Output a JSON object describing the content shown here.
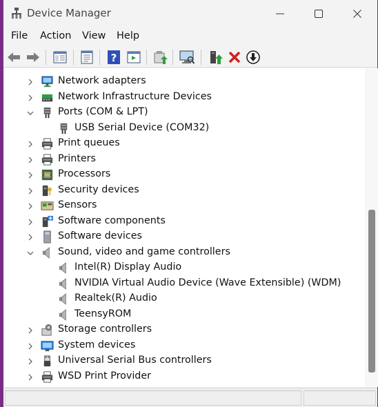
{
  "window": {
    "title": "Device Manager"
  },
  "menu": {
    "items": [
      "File",
      "Action",
      "View",
      "Help"
    ]
  },
  "toolbar": {
    "buttons": [
      "back-icon",
      "forward-icon",
      "show-hide-console-tree-icon",
      "properties-icon",
      "help-icon",
      "action-pane-icon",
      "update-driver-icon",
      "scan-hardware-icon",
      "enable-device-icon",
      "uninstall-device-icon",
      "disable-device-icon"
    ]
  },
  "tree": {
    "rows": [
      {
        "label": "Network adapters",
        "level": 0,
        "expanded": false,
        "icon": "network-adapter-icon"
      },
      {
        "label": "Network Infrastructure Devices",
        "level": 0,
        "expanded": false,
        "icon": "network-infrastructure-icon"
      },
      {
        "label": "Ports (COM & LPT)",
        "level": 0,
        "expanded": true,
        "icon": "port-icon"
      },
      {
        "label": "USB Serial Device (COM32)",
        "level": 1,
        "icon": "port-icon"
      },
      {
        "label": "Print queues",
        "level": 0,
        "expanded": false,
        "icon": "printer-icon"
      },
      {
        "label": "Printers",
        "level": 0,
        "expanded": false,
        "icon": "printer-icon"
      },
      {
        "label": "Processors",
        "level": 0,
        "expanded": false,
        "icon": "processor-icon"
      },
      {
        "label": "Security devices",
        "level": 0,
        "expanded": false,
        "icon": "security-device-icon"
      },
      {
        "label": "Sensors",
        "level": 0,
        "expanded": false,
        "icon": "sensor-icon"
      },
      {
        "label": "Software components",
        "level": 0,
        "expanded": false,
        "icon": "software-component-icon"
      },
      {
        "label": "Software devices",
        "level": 0,
        "expanded": false,
        "icon": "software-device-icon"
      },
      {
        "label": "Sound, video and game controllers",
        "level": 0,
        "expanded": true,
        "icon": "speaker-icon"
      },
      {
        "label": "Intel(R) Display Audio",
        "level": 1,
        "icon": "speaker-icon"
      },
      {
        "label": "NVIDIA Virtual Audio Device (Wave Extensible) (WDM)",
        "level": 1,
        "icon": "speaker-icon"
      },
      {
        "label": "Realtek(R) Audio",
        "level": 1,
        "icon": "speaker-icon"
      },
      {
        "label": "TeensyROM",
        "level": 1,
        "icon": "speaker-icon"
      },
      {
        "label": "Storage controllers",
        "level": 0,
        "expanded": false,
        "icon": "storage-controller-icon"
      },
      {
        "label": "System devices",
        "level": 0,
        "expanded": false,
        "icon": "system-device-icon"
      },
      {
        "label": "Universal Serial Bus controllers",
        "level": 0,
        "expanded": false,
        "icon": "usb-icon"
      },
      {
        "label": "WSD Print Provider",
        "level": 0,
        "expanded": false,
        "icon": "printer-icon"
      }
    ]
  },
  "colors": {
    "window_bg": "#f3f3f3",
    "tree_bg": "#ffffff",
    "desktop_accent": "#7a2a88",
    "uninstall_red": "#d0211c",
    "enable_green": "#2e9e3e"
  }
}
